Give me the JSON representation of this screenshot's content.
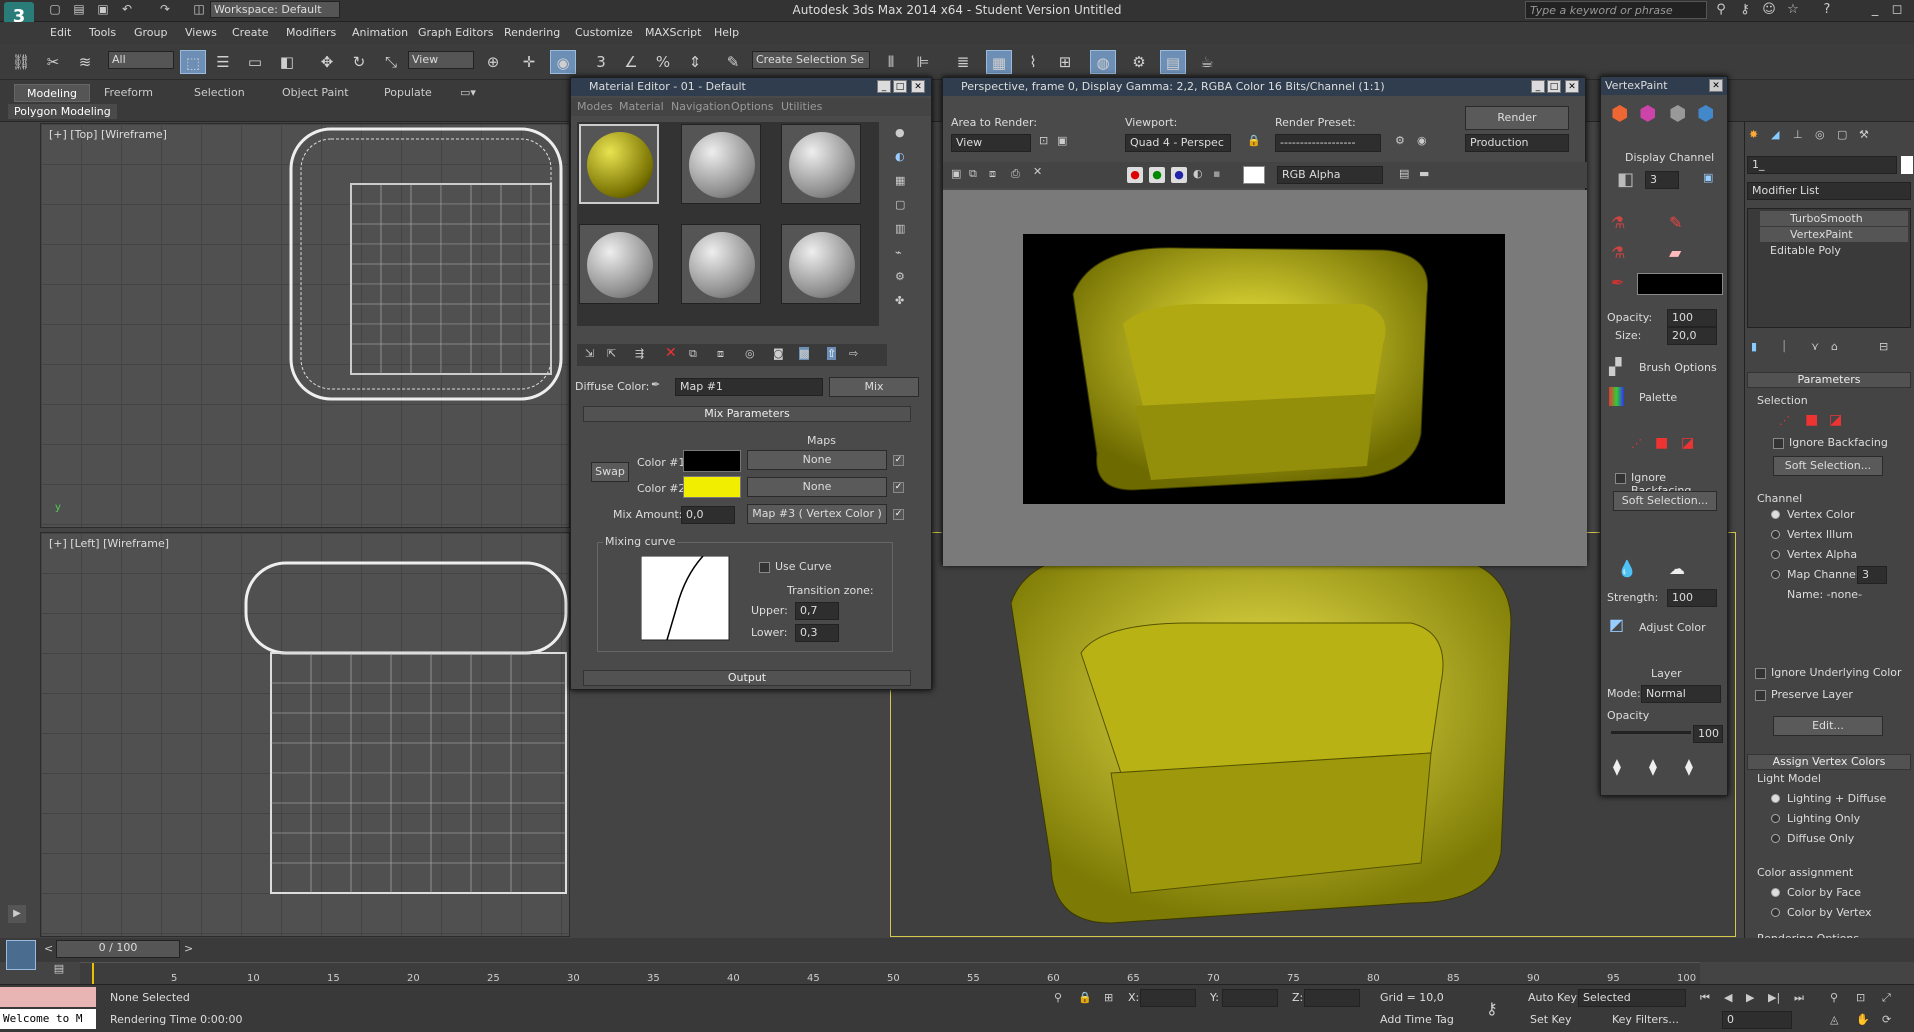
{
  "title_bar": {
    "title": "Autodesk 3ds Max  2014 x64  -  Student Version    Untitled",
    "workspace": "Workspace: Default",
    "search_placeholder": "Type a keyword or phrase"
  },
  "menu": [
    "Edit",
    "Tools",
    "Group",
    "Views",
    "Create",
    "Modifiers",
    "Animation",
    "Graph Editors",
    "Rendering",
    "Customize",
    "MAXScript",
    "Help"
  ],
  "toolbar": {
    "selection_filter": "All",
    "ref_coord": "View",
    "named_selection": "Create Selection Se"
  },
  "ribbon": {
    "tabs": [
      "Modeling",
      "Freeform",
      "Selection",
      "Object Paint",
      "Populate"
    ],
    "active": "Modeling",
    "sub_label": "Polygon Modeling"
  },
  "viewports": {
    "top": "[+] [Top] [Wireframe]",
    "left": "[+] [Left] [Wireframe]"
  },
  "material_editor": {
    "title": "Material Editor - 01 - Default",
    "menu": [
      "Modes",
      "Material",
      "Navigation",
      "Options",
      "Utilities"
    ],
    "diffuse_label": "Diffuse Color:",
    "map_name": "Map #1",
    "map_type": "Mix",
    "rollout": "Mix Parameters",
    "maps_header": "Maps",
    "swap": "Swap",
    "color1_label": "Color #1",
    "color2_label": "Color #2",
    "color1": "#000000",
    "color2": "#f2ee00",
    "map1": "None",
    "map2": "None",
    "mix_amount_label": "Mix Amount:",
    "mix_amount": "0,0",
    "mix_map": "Map #3  ( Vertex Color )",
    "mixing_curve": "Mixing curve",
    "use_curve": "Use Curve",
    "transition": "Transition zone:",
    "upper_label": "Upper:",
    "upper": "0,7",
    "lower_label": "Lower:",
    "lower": "0,3",
    "output": "Output"
  },
  "render_window": {
    "title": "Perspective, frame 0, Display Gamma: 2,2, RGBA Color 16 Bits/Channel (1:1)",
    "area_label": "Area to Render:",
    "area": "View",
    "viewport_label": "Viewport:",
    "viewport": "Quad 4 - Perspec",
    "preset_label": "Render Preset:",
    "preset": "-------------------",
    "render_btn": "Render",
    "production": "Production",
    "channel": "RGB Alpha"
  },
  "vertex_paint": {
    "title": "VertexPaint",
    "display_channel": "Display Channel",
    "channel_num": "3",
    "opacity_label": "Opacity:",
    "opacity": "100",
    "size_label": "Size:",
    "size": "20,0",
    "brush_options": "Brush Options",
    "palette": "Palette",
    "ignore_backfacing": "Ignore Backfacing",
    "soft_selection": "Soft Selection...",
    "strength_label": "Strength:",
    "strength": "100",
    "adjust_color": "Adjust Color",
    "layer": "Layer",
    "mode_label": "Mode:",
    "mode": "Normal",
    "layer_opacity_label": "Opacity",
    "layer_opacity": "100",
    "paint_color": "#000000"
  },
  "command_panel": {
    "object_name": "1_",
    "modifier_list": "Modifier List",
    "stack": [
      "TurboSmooth",
      "VertexPaint",
      "Editable Poly"
    ],
    "parameters": "Parameters",
    "selection": "Selection",
    "ignore_backfacing": "Ignore Backfacing",
    "soft_selection": "Soft Selection...",
    "channel": "Channel",
    "channels": [
      "Vertex Color",
      "Vertex Illum",
      "Vertex Alpha",
      "Map Channel"
    ],
    "map_channel_num": "3",
    "name_label": "Name: -none-",
    "ignore_underlying": "Ignore Underlying Color",
    "preserve_layer": "Preserve Layer",
    "edit": "Edit...",
    "assign": "Assign Vertex Colors",
    "light_model": "Light Model",
    "light_options": [
      "Lighting + Diffuse",
      "Lighting Only",
      "Diffuse Only"
    ],
    "color_assignment": "Color assignment",
    "assign_options": [
      "Color by Face",
      "Color by Vertex"
    ],
    "rendering_options": "Rendering Options"
  },
  "timeline": {
    "frame": "0 / 100",
    "ticks": [
      "5",
      "10",
      "15",
      "20",
      "25",
      "30",
      "35",
      "40",
      "45",
      "50",
      "55",
      "60",
      "65",
      "70",
      "75",
      "80",
      "85",
      "90",
      "95",
      "100"
    ]
  },
  "status": {
    "welcome": "Welcome to M",
    "selection": "None Selected",
    "render_time": "Rendering Time  0:00:00",
    "x": "X:",
    "y": "Y:",
    "z": "Z:",
    "grid": "Grid = 10,0",
    "auto_key": "Auto Key",
    "selected": "Selected",
    "set_key": "Set Key",
    "key_filters": "Key Filters...",
    "add_time_tag": "Add Time Tag",
    "frame_field": "0"
  }
}
